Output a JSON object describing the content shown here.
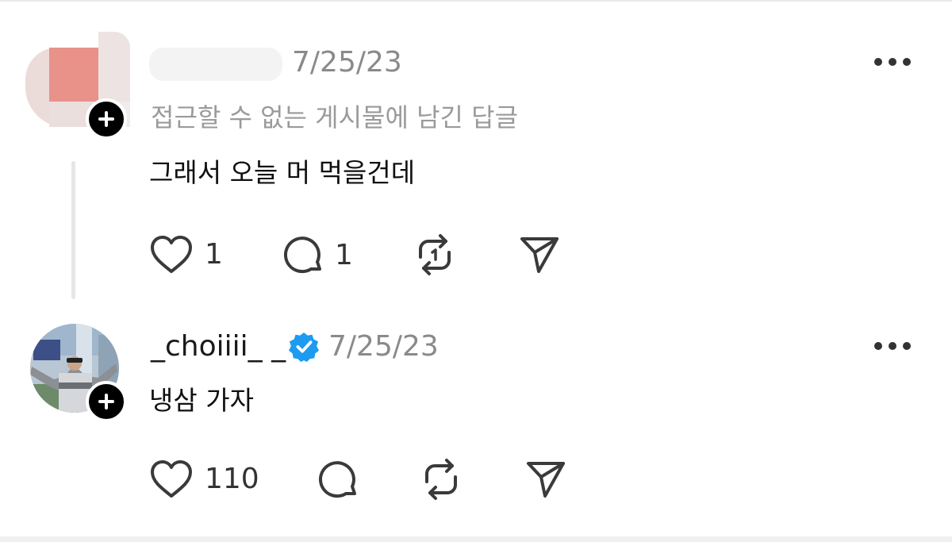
{
  "replies": [
    {
      "name": "",
      "timestamp": "7/25/23",
      "context": "접근할 수 없는 게시물에 남긴 답글",
      "text": "그래서 오늘 머 먹을건데",
      "likes": "1",
      "comments": "1"
    },
    {
      "name": "_choiiii_ _",
      "timestamp": "7/25/23",
      "verified": true,
      "text": "냉삼 가자",
      "likes": "110",
      "comments": ""
    }
  ],
  "colors": {
    "verified_blue": "#1d9bf0",
    "icon_stroke": "#3a3a3a",
    "muted_text": "#8a8a8a"
  },
  "icons": [
    "heart-icon",
    "comment-icon",
    "repost-icon",
    "share-icon",
    "more-icon",
    "plus-icon",
    "verified-icon"
  ]
}
